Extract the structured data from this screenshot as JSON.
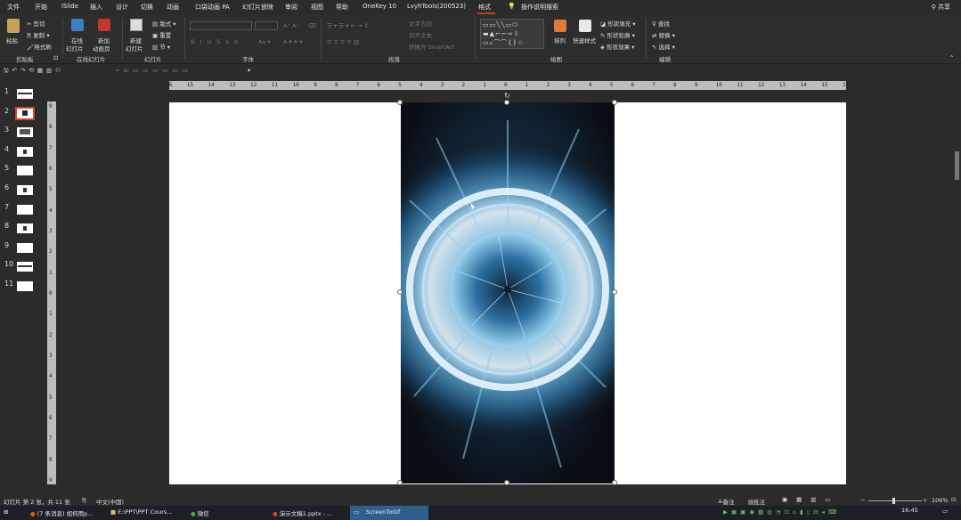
{
  "menu": {
    "tabs": [
      "文件",
      "开始",
      "iSlide",
      "插入",
      "设计",
      "切换",
      "动画",
      "口袋动画 PA",
      "幻灯片放映",
      "审阅",
      "视图",
      "帮助",
      "OneKey 10",
      "LvyhTools(200523)",
      "格式"
    ],
    "search": "操作说明搜索",
    "share": "共享"
  },
  "ribbon": {
    "clipboard": {
      "paste": "粘贴",
      "cut": "剪切",
      "copy": "复制",
      "format_painter": "格式刷",
      "group": "剪贴板"
    },
    "online": {
      "online_slides": "在线",
      "online_slides2": "幻灯片",
      "new_anim": "新加",
      "new_anim2": "动画页",
      "group": "在线幻灯片"
    },
    "slides": {
      "new_slide": "新建",
      "new_slide2": "幻灯片",
      "layout": "版式",
      "reset": "重置",
      "section": "节",
      "group": "幻灯片"
    },
    "font": {
      "group": "字体"
    },
    "paragraph": {
      "text_direction": "文字方向",
      "align_text": "对齐文本",
      "smartart": "转换为 SmartArt",
      "group": "段落"
    },
    "drawing": {
      "arrange": "排列",
      "quick_styles": "快速样式",
      "shape_fill": "形状填充",
      "shape_outline": "形状轮廓",
      "shape_effects": "形状效果",
      "group": "绘图"
    },
    "editing": {
      "find": "查找",
      "replace": "替换",
      "select": "选择",
      "group": "编辑"
    }
  },
  "thumbnails": [
    "1",
    "2",
    "3",
    "4",
    "5",
    "6",
    "7",
    "8",
    "9",
    "10",
    "11"
  ],
  "hruler": [
    "16",
    "15",
    "14",
    "13",
    "12",
    "11",
    "10",
    "9",
    "8",
    "7",
    "6",
    "5",
    "4",
    "3",
    "2",
    "1",
    "0",
    "1",
    "2",
    "3",
    "4",
    "5",
    "6",
    "7",
    "8",
    "9",
    "10",
    "11",
    "12",
    "13",
    "14",
    "15",
    "16"
  ],
  "vruler": [
    "9",
    "8",
    "7",
    "6",
    "5",
    "4",
    "3",
    "2",
    "1",
    "0",
    "1",
    "2",
    "3",
    "4",
    "5",
    "6",
    "7",
    "8",
    "9"
  ],
  "status": {
    "slide_info": "幻灯片 第 2 张，共 11 张",
    "language": "中文(中国)",
    "notes": "备注",
    "comments": "批注",
    "zoom": "106%"
  },
  "taskbar": {
    "items": [
      "(7 条消息) 如何用p...",
      "E:\\PPT\\PPT Cours...",
      "微信",
      "演示文稿1.pptx - ...",
      "ScreenToGif"
    ],
    "time": "16:45"
  },
  "colors": {
    "accent": "#c43e1c",
    "selection": "#d24726",
    "taskbar_active": "#2e5f8f"
  }
}
